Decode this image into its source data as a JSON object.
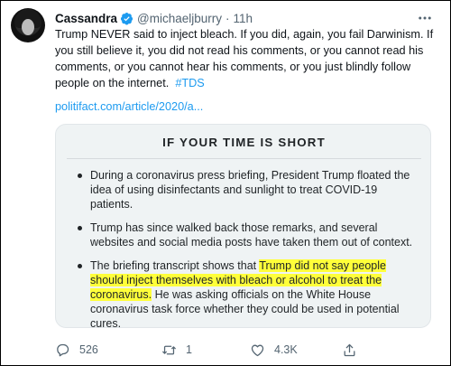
{
  "tweet": {
    "author_name": "Cassandra",
    "handle": "@michaeljburry",
    "separator": "·",
    "time": "11h",
    "text": "Trump NEVER said to inject bleach. If you did, again, you fail Darwinism. If you still believe it, you did not read his comments, or you cannot read his comments, or you cannot hear his comments, or you just blindly follow people on the internet.",
    "hashtag": "#TDS",
    "link": "politifact.com/article/2020/a..."
  },
  "card": {
    "title": "IF YOUR TIME IS SHORT",
    "bullets": [
      "During a coronavirus press briefing, President Trump floated the idea of using disinfectants and sunlight to treat COVID-19 patients.",
      "Trump has since walked back those remarks, and several websites and social media posts have taken them out of context."
    ],
    "bullet3": {
      "before": "The briefing transcript shows that ",
      "highlighted": "Trump did not say people should inject themselves with bleach or alcohol to treat the coronavirus.",
      "after": " He was asking officials on the White House coronavirus task force whether they could be used in potential cures."
    },
    "highlight_color": "#ffff3a"
  },
  "actions": {
    "replies": "526",
    "retweets": "1",
    "likes": "4.3K"
  },
  "icons": {
    "verified": "verified-badge-icon",
    "more": "more-dots-icon",
    "reply": "reply-icon",
    "retweet": "retweet-icon",
    "like": "heart-icon",
    "share": "share-icon"
  },
  "colors": {
    "link": "#1d9bf0",
    "muted": "#536471",
    "card_bg": "#eff3f4"
  }
}
